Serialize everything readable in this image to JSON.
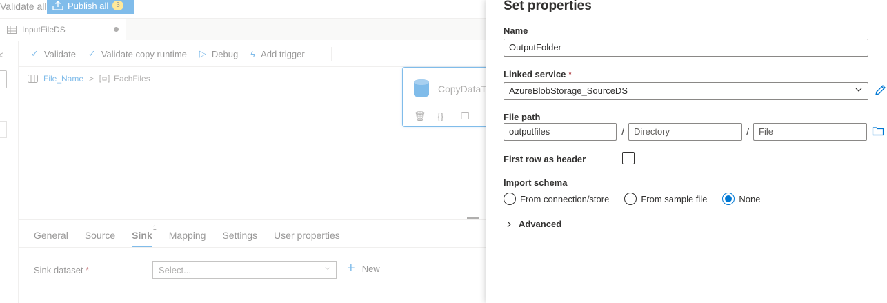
{
  "topbar": {
    "validate_all": "Validate all",
    "publish_all": "Publish all",
    "publish_count": "3"
  },
  "tabs": [
    {
      "label": "InputFileDS"
    }
  ],
  "toolbar": {
    "validate": "Validate",
    "validate_copy_runtime": "Validate copy runtime",
    "debug": "Debug",
    "add_trigger": "Add trigger"
  },
  "breadcrumb": {
    "item1": "File_Name",
    "separator": ">",
    "item2": "EachFiles"
  },
  "activity": {
    "name": "CopyDataTo"
  },
  "bottom_tabs": [
    {
      "label": "General"
    },
    {
      "label": "Source"
    },
    {
      "label": "Sink",
      "badge": "1"
    },
    {
      "label": "Mapping"
    },
    {
      "label": "Settings"
    },
    {
      "label": "User properties"
    }
  ],
  "sink": {
    "label": "Sink dataset",
    "required_mark": "*",
    "select_placeholder": "Select...",
    "new_label": "New"
  },
  "panel": {
    "title": "Set properties",
    "name_label": "Name",
    "name_value": "OutputFolder",
    "linked_service_label": "Linked service",
    "required_mark": "*",
    "linked_service_value": "AzureBlobStorage_SourceDS",
    "file_path_label": "File path",
    "file_path_container": "outputfiles",
    "file_path_directory_placeholder": "Directory",
    "file_path_file_placeholder": "File",
    "path_separator": "/",
    "first_row_header_label": "First row as header",
    "first_row_header_checked": false,
    "import_schema_label": "Import schema",
    "import_schema_options": [
      {
        "label": "From connection/store",
        "checked": false
      },
      {
        "label": "From sample file",
        "checked": false
      },
      {
        "label": "None",
        "checked": true
      }
    ],
    "advanced_label": "Advanced"
  },
  "colors": {
    "accent": "#0078d4",
    "required": "#a4262c",
    "badge": "#ffd335"
  }
}
